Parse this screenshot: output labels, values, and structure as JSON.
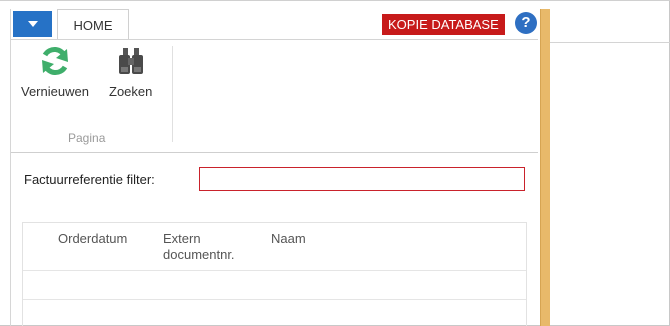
{
  "ribbon": {
    "tab_home": "HOME",
    "badge": "KOPIE DATABASE",
    "help": "?",
    "buttons": {
      "refresh_label": "Vernieuwen",
      "find_label": "Zoeken"
    },
    "group_label": "Pagina"
  },
  "filter": {
    "label": "Factuurreferentie filter:",
    "value": ""
  },
  "table": {
    "columns": [
      "Orderdatum",
      "Extern documentnr.",
      "Naam"
    ],
    "col2_line1": "Extern",
    "col2_line2": "documentnr."
  },
  "colors": {
    "accent_blue": "#2672c6",
    "badge_red": "#c71a1a",
    "splitter_orange": "#e8b96a",
    "refresh_green": "#3fae6b"
  },
  "icons": [
    "app-menu-dropdown-icon",
    "help-icon",
    "refresh-icon",
    "binoculars-icon"
  ]
}
